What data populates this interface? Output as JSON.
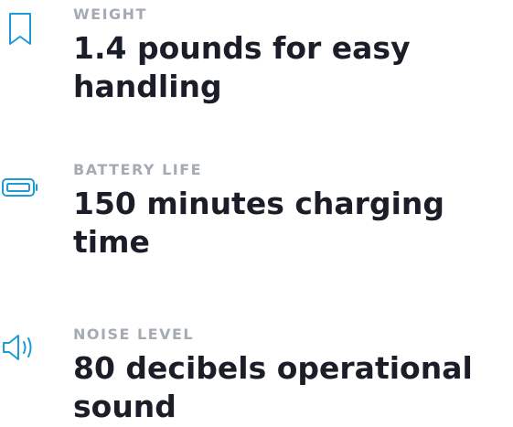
{
  "specs": [
    {
      "icon": "bookmark-icon",
      "label": "WEIGHT",
      "value": "1.4 pounds for easy handling"
    },
    {
      "icon": "battery-icon",
      "label": "BATTERY LIFE",
      "value": "150 minutes charging time"
    },
    {
      "icon": "speaker-icon",
      "label": "NOISE LEVEL",
      "value": "80 decibels operational sound"
    }
  ],
  "colors": {
    "accent": "#1e9bd7",
    "label": "#a5abb2",
    "value": "#1b1e28"
  }
}
